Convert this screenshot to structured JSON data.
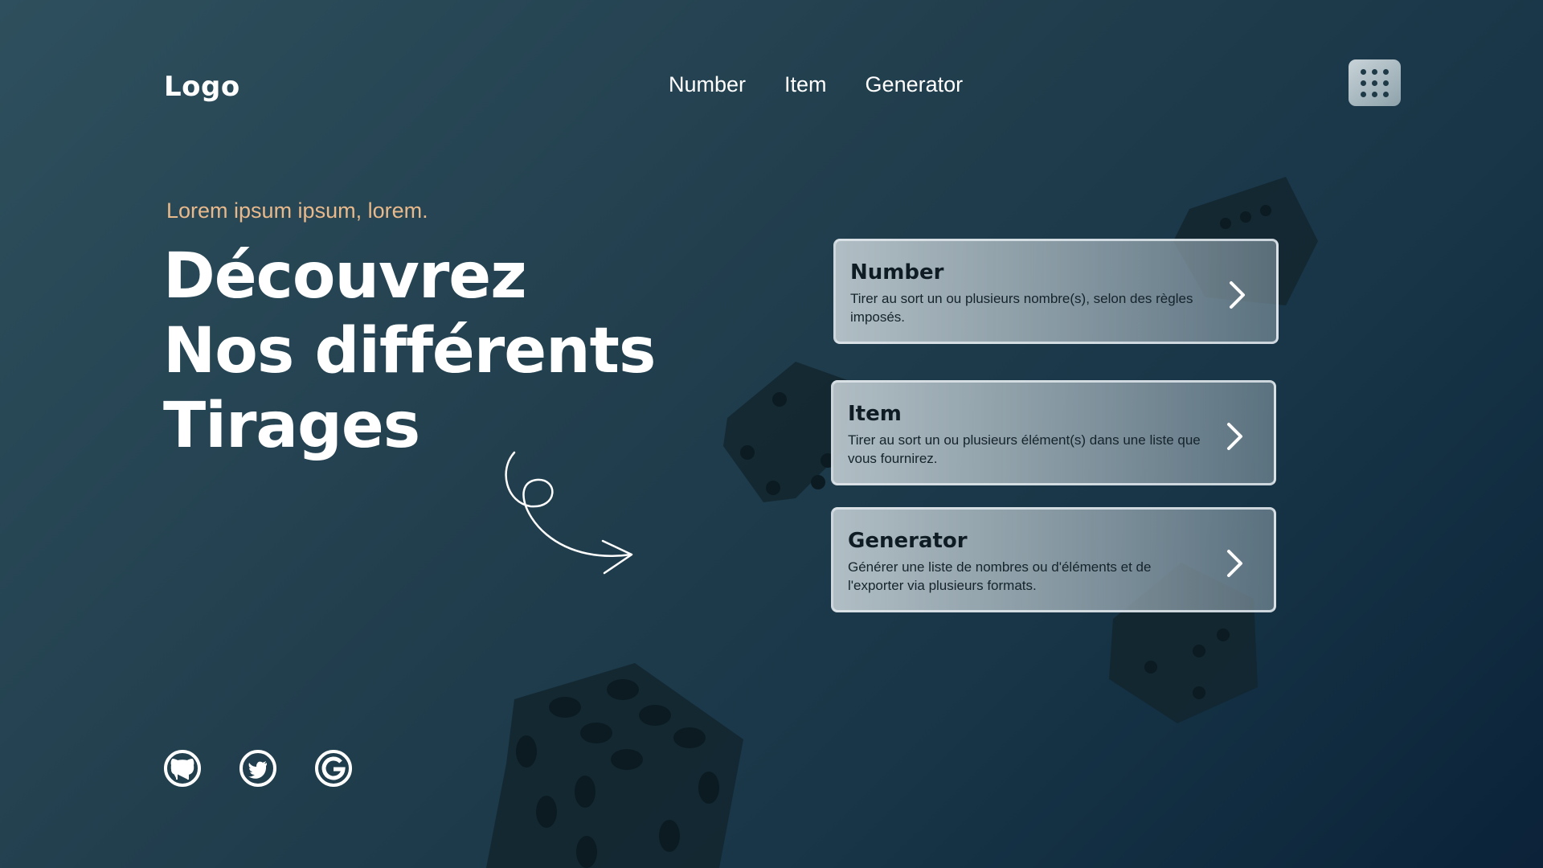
{
  "header": {
    "logo": "Logo",
    "nav": [
      {
        "label": "Number"
      },
      {
        "label": "Item"
      },
      {
        "label": "Generator"
      }
    ],
    "menu_icon": "grid-icon"
  },
  "hero": {
    "kicker": "Lorem ipsum ipsum, lorem.",
    "lines": [
      "Découvrez",
      "Nos différents",
      "Tirages"
    ]
  },
  "cards": [
    {
      "title": "Number",
      "description": "Tirer au sort un ou plusieurs nombre(s), selon des règles imposés.",
      "icon": "chevron-right-icon"
    },
    {
      "title": "Item",
      "description": "Tirer au sort un ou plusieurs élément(s) dans une liste que vous fournirez.",
      "icon": "chevron-right-icon"
    },
    {
      "title": "Generator",
      "description": "Générer une liste de nombres ou d'éléments et de l'exporter via plusieurs formats.",
      "icon": "chevron-right-icon"
    }
  ],
  "socials": [
    {
      "icon": "github-icon"
    },
    {
      "icon": "twitter-icon"
    },
    {
      "icon": "google-icon"
    }
  ],
  "colors": {
    "background_start": "#2e4f5d",
    "background_end": "#0b2238",
    "accent": "#e8b98b",
    "text": "#ffffff",
    "dice": "#13272f"
  }
}
